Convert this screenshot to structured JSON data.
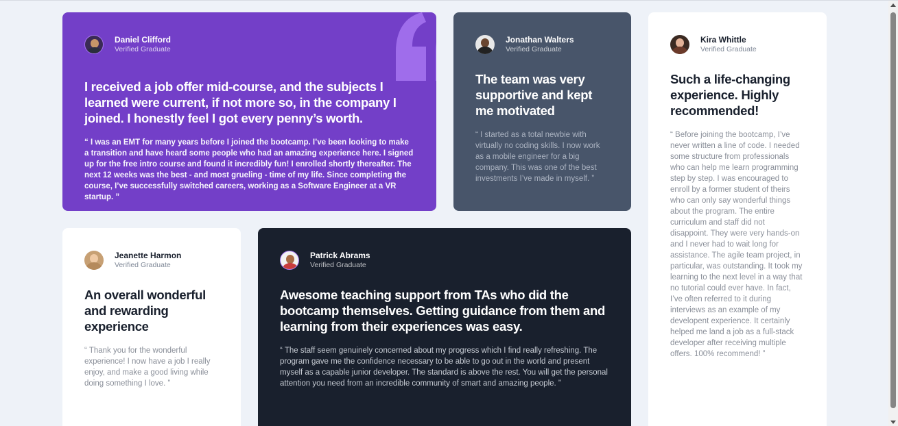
{
  "testimonials": [
    {
      "name": "Daniel Clifford",
      "status": "Verified Graduate",
      "headline": "I received a job offer mid-course, and the subjects I learned were current, if not more so, in the company I joined. I honestly feel I got every penny’s worth.",
      "quote": "“ I was an EMT for many years before I joined the bootcamp. I’ve been looking to make a transition and have heard some people who had an amazing experience here. I signed up for the free intro course and found it incredibly fun! I enrolled shortly thereafter. The next 12 weeks was the best - and most grueling - time of my life. Since completing the course, I’ve successfully switched careers, working as a Software Engineer at a VR startup. ”"
    },
    {
      "name": "Jonathan Walters",
      "status": "Verified Graduate",
      "headline": "The team was very supportive and kept me motivated",
      "quote": "“ I started as a total newbie with virtually no coding skills. I now work as a mobile engineer for a big company. This was one of the best investments I’ve made in myself. ”"
    },
    {
      "name": "Kira Whittle",
      "status": "Verified Graduate",
      "headline": "Such a life-changing experience. Highly recommended!",
      "quote": "“ Before joining the bootcamp, I’ve never written a line of code. I needed some structure from professionals who can help me learn programming step by step. I was encouraged to enroll by a former student of theirs who can only say wonderful things about the program. The entire curriculum and staff did not disappoint. They were very hands-on and I never had to wait long for assistance. The agile team project, in particular, was outstanding. It took my learning to the next level in a way that no tutorial could ever have. In fact, I’ve often referred to it during interviews as an example of my developent experience. It certainly helped me land a job as a full-stack developer after receiving multiple offers. 100% recommend! ”"
    },
    {
      "name": "Jeanette Harmon",
      "status": "Verified Graduate",
      "headline": "An overall wonderful and rewarding experience",
      "quote": "“ Thank you for the wonderful experience! I now have a job I really enjoy, and make a good living while doing something I love. ”"
    },
    {
      "name": "Patrick Abrams",
      "status": "Verified Graduate",
      "headline": "Awesome teaching support from TAs who did the bootcamp themselves. Getting guidance from them and learning from their experiences was easy.",
      "quote": "“ The staff seem genuinely concerned about my progress which I find really refreshing. The program gave me the confidence necessary to be able to go out in the world and present myself as a capable junior developer. The standard is above the rest. You will get the personal attention you need from an incredible community of smart and amazing people. ”"
    }
  ],
  "colors": {
    "purple": "#733fc8",
    "slate": "#48556a",
    "white": "#ffffff",
    "dark": "#19202d",
    "background": "#eef2f8",
    "quote_mark": "#a775f1"
  },
  "icons": {
    "quote_mark": "quotation-mark-icon"
  }
}
